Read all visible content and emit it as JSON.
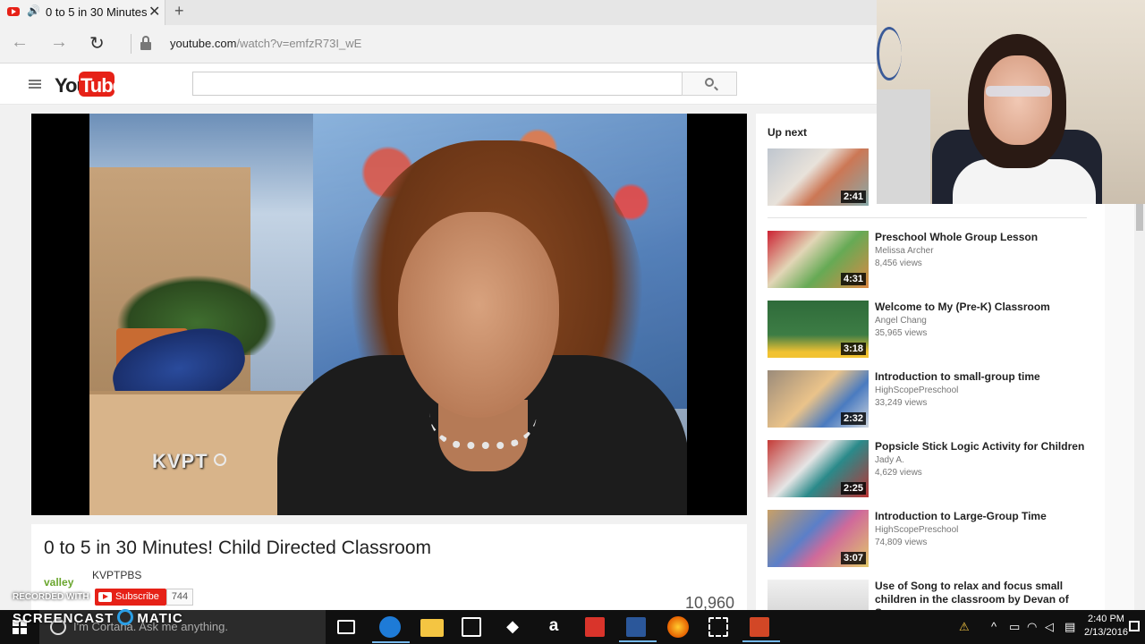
{
  "browser": {
    "tab_title": "0 to 5 in 30 Minutes",
    "tab_close": "✕",
    "new_tab": "+",
    "url_host": "youtube.com",
    "url_path": "/watch?v=emfzR73I_wE",
    "back": "←",
    "forward": "→",
    "refresh": "↻"
  },
  "youtube": {
    "logo_you": "You",
    "logo_tube": "Tube",
    "search_placeholder": ""
  },
  "player": {
    "watermark": "KVPT"
  },
  "video": {
    "title": "0 to 5 in 30 Minutes! Child Directed Classroom",
    "channel_logo_text": "valley",
    "channel": "KVPTPBS",
    "subscribe_label": "Subscribe",
    "subscriber_count": "744",
    "view_count": "10,960"
  },
  "sidebar": {
    "up_next_label": "Up next",
    "items": [
      {
        "title": "",
        "channel": "",
        "views": "",
        "duration": "2:41"
      },
      {
        "title": "Preschool Whole Group Lesson",
        "channel": "Melissa Archer",
        "views": "8,456 views",
        "duration": "4:31"
      },
      {
        "title": "Welcome to My (Pre-K) Classroom",
        "channel": "Angel Chang",
        "views": "35,965 views",
        "duration": "3:18"
      },
      {
        "title": "Introduction to small-group time",
        "channel": "HighScopePreschool",
        "views": "33,249 views",
        "duration": "2:32"
      },
      {
        "title": "Popsicle Stick Logic Activity for Children",
        "channel": "Jady A.",
        "views": "4,629 views",
        "duration": "2:25"
      },
      {
        "title": "Introduction to Large-Group Time",
        "channel": "HighScopePreschool",
        "views": "74,809 views",
        "duration": "3:07"
      },
      {
        "title": "Use of Song to relax and focus small children in the classroom by Devan of Super",
        "channel": "",
        "views": "",
        "duration": ""
      }
    ]
  },
  "overlay": {
    "recorded_with": "RECORDED WITH",
    "screencast_left": "SCREENCAST",
    "screencast_right": "MATIC"
  },
  "taskbar": {
    "cortana_placeholder": "I'm Cortana. Ask me anything.",
    "time": "2:40 PM",
    "date": "2/13/2016",
    "apps": [
      "task-view",
      "edge",
      "file-explorer",
      "store",
      "dropbox",
      "amazon",
      "wps",
      "word",
      "firefox",
      "snipping",
      "powerpoint"
    ],
    "colors": {
      "edge": "#1e7bd7",
      "explorer": "#f4c542",
      "dropbox": "#ffffff",
      "amazon": "#ffffff",
      "wps": "#d9342b",
      "word": "#2b579a",
      "firefox": "#e66000",
      "powerpoint": "#d24726"
    }
  }
}
